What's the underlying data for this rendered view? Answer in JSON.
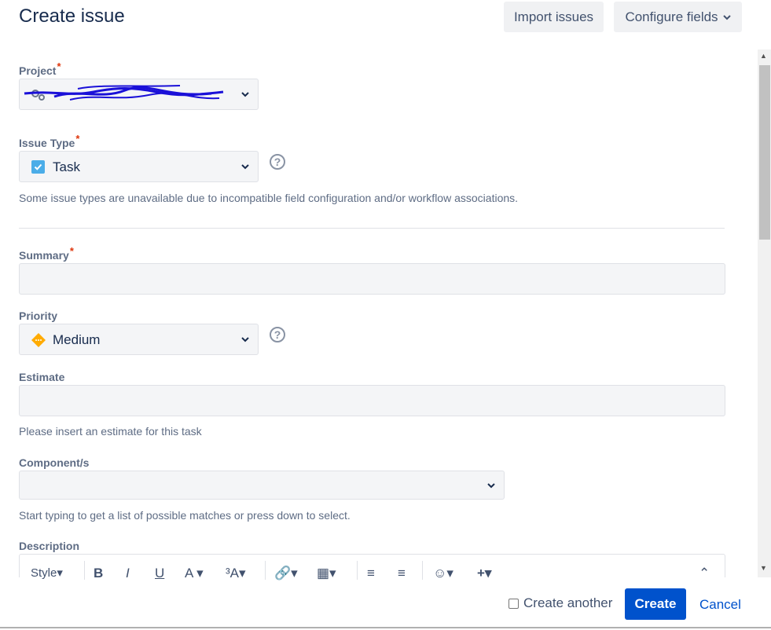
{
  "header": {
    "title": "Create issue",
    "import_label": "Import issues",
    "configure_label": "Configure fields"
  },
  "project": {
    "label": "Project",
    "required_mark": "*",
    "value_redacted": true
  },
  "issue_type": {
    "label": "Issue Type",
    "required_mark": "*",
    "value": "Task",
    "hint": "Some issue types are unavailable due to incompatible field configuration and/or workflow associations."
  },
  "summary": {
    "label": "Summary",
    "required_mark": "*",
    "value": ""
  },
  "priority": {
    "label": "Priority",
    "value": "Medium"
  },
  "estimate": {
    "label": "Estimate",
    "value": "",
    "hint": "Please insert an estimate for this task"
  },
  "components": {
    "label": "Component/s",
    "value": "",
    "hint": "Start typing to get a list of possible matches or press down to select."
  },
  "description": {
    "label": "Description",
    "toolbar": {
      "style_label": "Style",
      "bold": "B",
      "italic": "I",
      "underline": "U",
      "text_color": "A",
      "text_size": "³A"
    }
  },
  "footer": {
    "create_another_label": "Create another",
    "create_another_checked": false,
    "create_label": "Create",
    "cancel_label": "Cancel"
  },
  "colors": {
    "primary": "#0052cc",
    "required": "#de350b",
    "task_icon": "#4bade8",
    "priority_medium": "#ffab00"
  }
}
